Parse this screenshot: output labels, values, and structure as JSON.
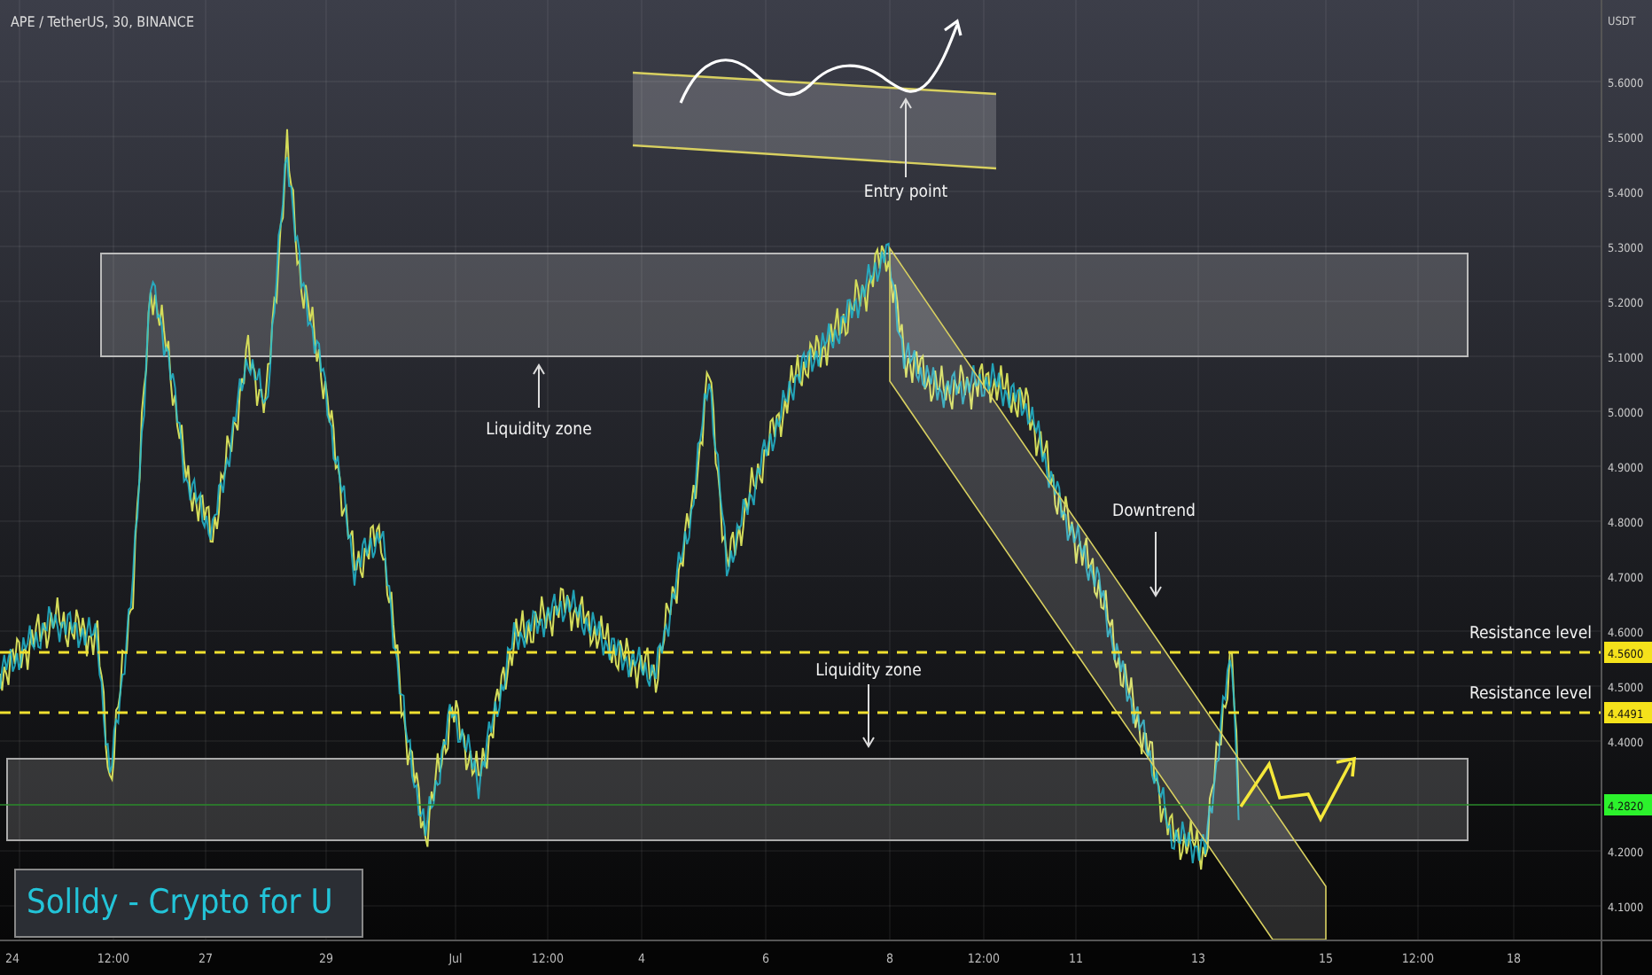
{
  "chart": {
    "symbol": "APE / TetherUS, 30, BINANCE",
    "labels": [
      "Entry point",
      "Liquidity zone",
      "Downtrend",
      "Liquidity zone",
      "Resistance level",
      "Resistance level"
    ],
    "branding": "Solldy - Crypto for U"
  },
  "price_axis": {
    "currency": "USDT",
    "ticks": [
      "5.6000",
      "5.5000",
      "5.4000",
      "5.3000",
      "5.2000",
      "5.1000",
      "5.0000",
      "4.9000",
      "4.8000",
      "4.7000",
      "4.6000",
      "4.5000",
      "4.4000",
      "4.2000",
      "4.1000"
    ],
    "markers": [
      {
        "text": "4.5600",
        "color": "#f5e21b"
      },
      {
        "text": "4.4491",
        "color": "#f5e21b"
      },
      {
        "text": "4.2820",
        "color": "#2cf22c"
      }
    ]
  },
  "time_axis": {
    "ticks": [
      "24",
      "12:00",
      "27",
      "29",
      "Jul",
      "12:00",
      "4",
      "6",
      "8",
      "12:00",
      "11",
      "13",
      "15",
      "12:00",
      "18"
    ]
  }
}
